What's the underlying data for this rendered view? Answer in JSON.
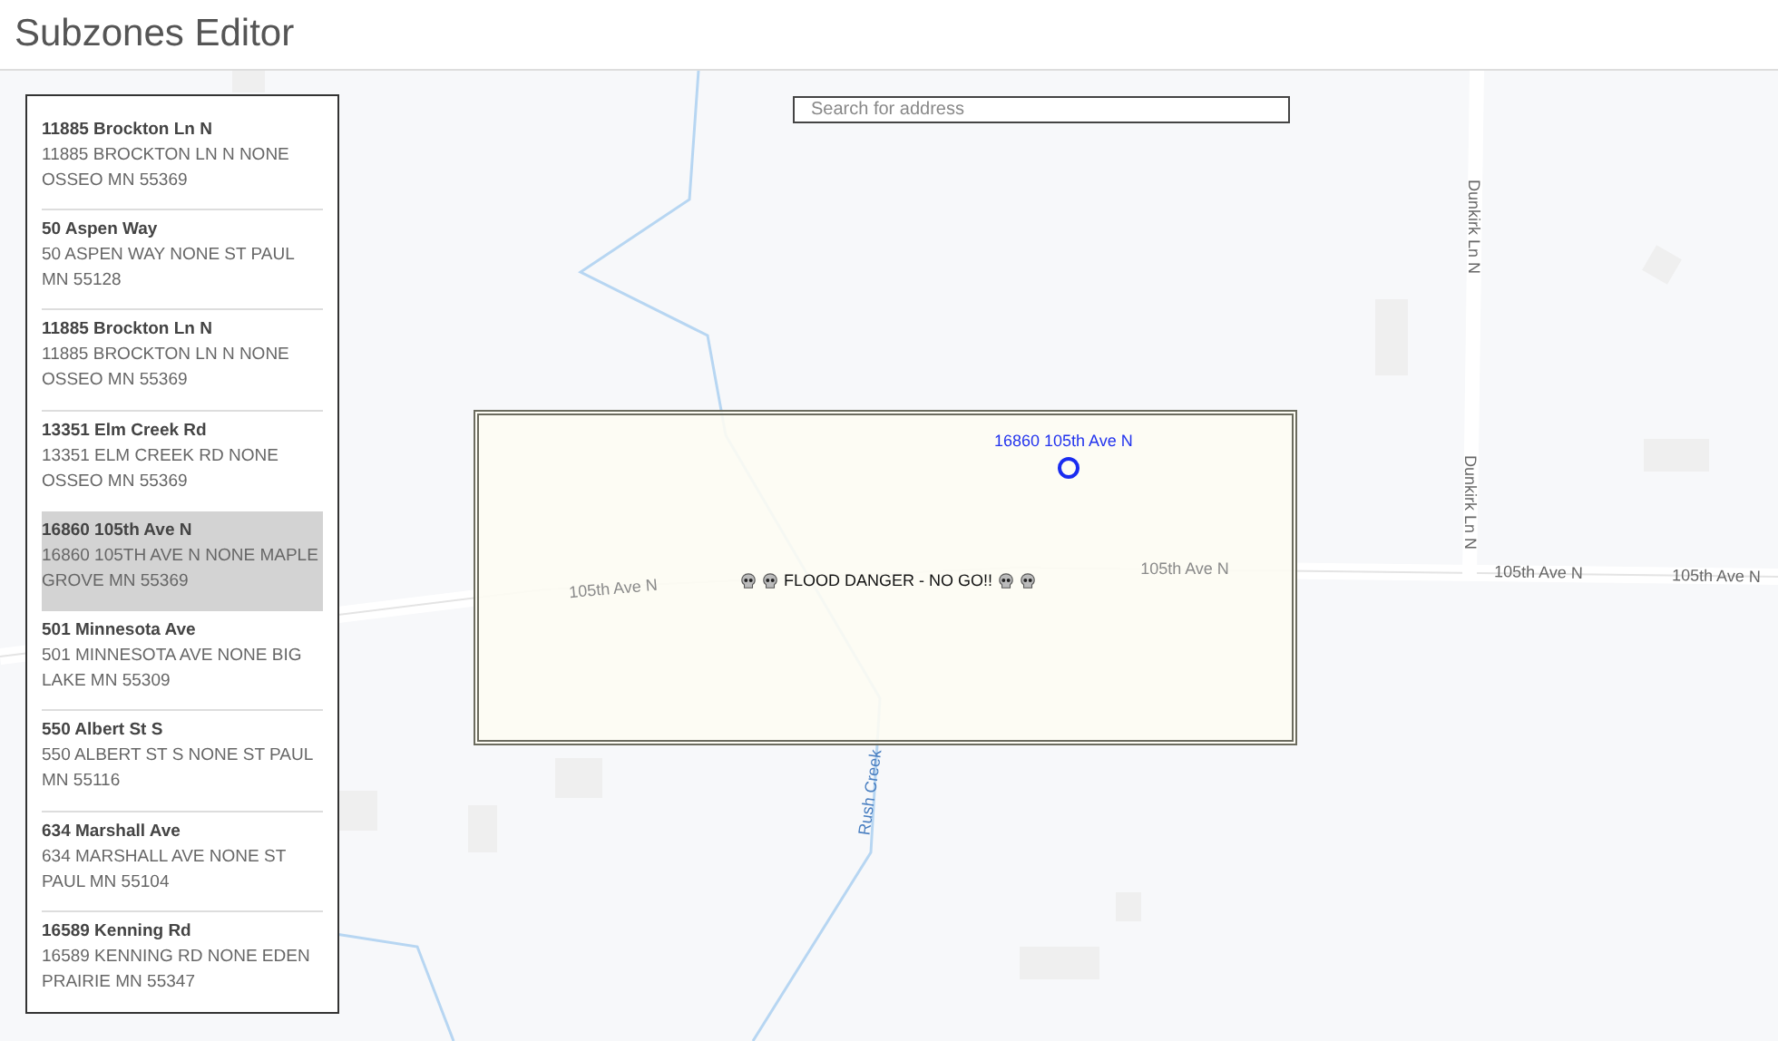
{
  "header": {
    "title": "Subzones Editor"
  },
  "search": {
    "placeholder": "Search for address"
  },
  "addresses": [
    {
      "name": "11885 Brockton Ln N",
      "address": "11885 BROCKTON LN N NONE OSSEO MN 55369",
      "selected": false
    },
    {
      "name": "50 Aspen Way",
      "address": "50 ASPEN WAY NONE ST PAUL MN 55128",
      "selected": false
    },
    {
      "name": "11885 Brockton Ln N",
      "address": "11885 BROCKTON LN N NONE OSSEO MN 55369",
      "selected": false
    },
    {
      "name": "13351 Elm Creek Rd",
      "address": "13351 ELM CREEK RD NONE OSSEO MN 55369",
      "selected": false
    },
    {
      "name": "16860 105th Ave N",
      "address": "16860 105TH AVE N NONE MAPLE GROVE MN 55369",
      "selected": true
    },
    {
      "name": "501 Minnesota Ave",
      "address": "501 MINNESOTA AVE NONE BIG LAKE MN 55309",
      "selected": false
    },
    {
      "name": "550 Albert St S",
      "address": "550 ALBERT ST S NONE ST PAUL MN 55116",
      "selected": false
    },
    {
      "name": "634 Marshall Ave",
      "address": "634 MARSHALL AVE NONE ST PAUL MN 55104",
      "selected": false
    },
    {
      "name": "16589 Kenning Rd",
      "address": "16589 KENNING RD NONE EDEN PRAIRIE MN 55347",
      "selected": false
    }
  ],
  "map": {
    "street_labels": [
      "105th Ave N",
      "105th Ave N",
      "105th Ave N",
      "105th Ave N",
      "Dunkirk Ln N",
      "Dunkirk Ln N",
      "Rush Creek"
    ],
    "subzone": {
      "label": "FLOOD DANGER - NO GO!!"
    },
    "marker": {
      "label": "16860 105th Ave N"
    }
  }
}
